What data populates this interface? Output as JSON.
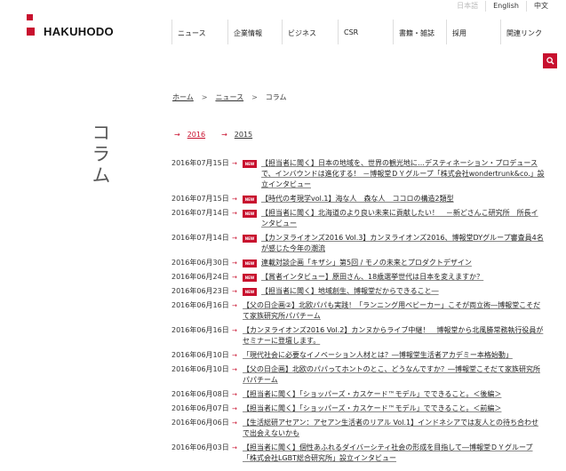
{
  "lang": [
    "日本語",
    "English",
    "中文"
  ],
  "logo": {
    "text": "HAKUHODO"
  },
  "nav": [
    "ニュース",
    "企業情報",
    "ビジネス",
    "CSR",
    "書籍・雑誌",
    "採用",
    "関連リンク"
  ],
  "icons": {
    "search": "search-icon",
    "arrow": "arrow-right-icon"
  },
  "colors": {
    "accent": "#c8102e"
  },
  "breadcrumb": {
    "home": "ホーム",
    "news": "ニュース",
    "current": "コラム",
    "sep": ">"
  },
  "page_title": "コラム",
  "year_tabs": [
    "2016",
    "2015"
  ],
  "arrow_glyph": "→",
  "new_badge": "NEW",
  "news_items": [
    {
      "date": "2016年07月15日",
      "new": true,
      "title": "【担当者に聞く】日本の地域を、世界の観光地に…デスティネーション・プロデュースで、インバウンドは進化する！ －博報堂ＤＹグループ「株式会社wondertrunk&co.」設立インタビュー"
    },
    {
      "date": "2016年07月15日",
      "new": true,
      "title": "【時代の考現学vol.1】海な人　森な人　ココロの構造2類型"
    },
    {
      "date": "2016年07月14日",
      "new": true,
      "title": "【担当者に聞く】北海道のより良い未来に貢献したい！　－新どさんこ研究所　所長インタビュー"
    },
    {
      "date": "2016年07月14日",
      "new": true,
      "title": "【カンヌライオンズ2016 Vol.3】カンヌライオンズ2016、博報堂DYグループ審査員4名が感じた今年の潮流"
    },
    {
      "date": "2016年06月30日",
      "new": true,
      "title": "連載対談企画「キザシ」第5回 / モノの未来とプロダクトデザイン"
    },
    {
      "date": "2016年06月24日",
      "new": true,
      "title": "【賞者インタビュー】原田さん、18歳選挙世代は日本を変えますか？"
    },
    {
      "date": "2016年06月23日",
      "new": true,
      "title": "【担当者に聞く】地域創生、博報堂だからできること―"
    },
    {
      "date": "2016年06月16日",
      "new": false,
      "title": "【父の日企画②】北欧パパも実践！「ランニング用ベビーカー」こそが両立術―博報堂こそだて家族研究所パパチーム"
    },
    {
      "date": "2016年06月16日",
      "new": false,
      "title": "【カンヌライオンズ2016 Vol.2】カンヌからライブ中継！　博報堂から北風勝常務執行役員がセミナーに登壇します。"
    },
    {
      "date": "2016年06月10日",
      "new": false,
      "title": "「現代社会に必要なイノベーション人材とは？―博報堂生活者アカデミー本格始動」"
    },
    {
      "date": "2016年06月10日",
      "new": false,
      "title": "【父の日企画】北欧のパパってホントのとこ、どうなんですか？―博報堂こそだて家族研究所パパチーム"
    },
    {
      "date": "2016年06月08日",
      "new": false,
      "title": "【担当者に聞く】「ショッパーズ・カスケード™モデル」でできること。＜後編＞"
    },
    {
      "date": "2016年06月07日",
      "new": false,
      "title": "【担当者に聞く】「ショッパーズ・カスケード™モデル」でできること。＜前編＞"
    },
    {
      "date": "2016年06月06日",
      "new": false,
      "title": "【生活総研アセアン：アセアン生活者のリアル Vol.1】インドネシアでは友人との待ち合わせで出会えないかも"
    },
    {
      "date": "2016年06月03日",
      "new": false,
      "title": "【担当者に聞く】個性あふれるダイバーシティ社会の形成を目指して―博報堂ＤＹグループ「株式会社LGBT総合研究所」設立インタビュー"
    }
  ]
}
